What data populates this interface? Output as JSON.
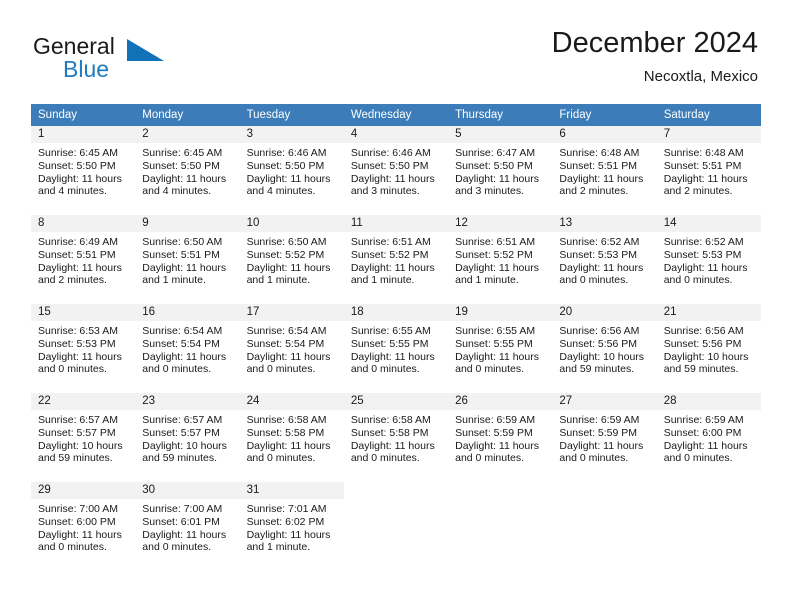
{
  "brand": {
    "line1": "General",
    "line2": "Blue",
    "logo_icon": "triangle-flag-icon",
    "accent_color": "#1272b8"
  },
  "header": {
    "title": "December 2024",
    "subtitle": "Necoxtla, Mexico"
  },
  "calendar": {
    "header_bg": "#3b7cb9",
    "daynum_bg": "#f2f2f2",
    "weekdays": [
      "Sunday",
      "Monday",
      "Tuesday",
      "Wednesday",
      "Thursday",
      "Friday",
      "Saturday"
    ],
    "weeks": [
      [
        {
          "day": "1",
          "sunrise": "Sunrise: 6:45 AM",
          "sunset": "Sunset: 5:50 PM",
          "daylight1": "Daylight: 11 hours",
          "daylight2": "and 4 minutes."
        },
        {
          "day": "2",
          "sunrise": "Sunrise: 6:45 AM",
          "sunset": "Sunset: 5:50 PM",
          "daylight1": "Daylight: 11 hours",
          "daylight2": "and 4 minutes."
        },
        {
          "day": "3",
          "sunrise": "Sunrise: 6:46 AM",
          "sunset": "Sunset: 5:50 PM",
          "daylight1": "Daylight: 11 hours",
          "daylight2": "and 4 minutes."
        },
        {
          "day": "4",
          "sunrise": "Sunrise: 6:46 AM",
          "sunset": "Sunset: 5:50 PM",
          "daylight1": "Daylight: 11 hours",
          "daylight2": "and 3 minutes."
        },
        {
          "day": "5",
          "sunrise": "Sunrise: 6:47 AM",
          "sunset": "Sunset: 5:50 PM",
          "daylight1": "Daylight: 11 hours",
          "daylight2": "and 3 minutes."
        },
        {
          "day": "6",
          "sunrise": "Sunrise: 6:48 AM",
          "sunset": "Sunset: 5:51 PM",
          "daylight1": "Daylight: 11 hours",
          "daylight2": "and 2 minutes."
        },
        {
          "day": "7",
          "sunrise": "Sunrise: 6:48 AM",
          "sunset": "Sunset: 5:51 PM",
          "daylight1": "Daylight: 11 hours",
          "daylight2": "and 2 minutes."
        }
      ],
      [
        {
          "day": "8",
          "sunrise": "Sunrise: 6:49 AM",
          "sunset": "Sunset: 5:51 PM",
          "daylight1": "Daylight: 11 hours",
          "daylight2": "and 2 minutes."
        },
        {
          "day": "9",
          "sunrise": "Sunrise: 6:50 AM",
          "sunset": "Sunset: 5:51 PM",
          "daylight1": "Daylight: 11 hours",
          "daylight2": "and 1 minute."
        },
        {
          "day": "10",
          "sunrise": "Sunrise: 6:50 AM",
          "sunset": "Sunset: 5:52 PM",
          "daylight1": "Daylight: 11 hours",
          "daylight2": "and 1 minute."
        },
        {
          "day": "11",
          "sunrise": "Sunrise: 6:51 AM",
          "sunset": "Sunset: 5:52 PM",
          "daylight1": "Daylight: 11 hours",
          "daylight2": "and 1 minute."
        },
        {
          "day": "12",
          "sunrise": "Sunrise: 6:51 AM",
          "sunset": "Sunset: 5:52 PM",
          "daylight1": "Daylight: 11 hours",
          "daylight2": "and 1 minute."
        },
        {
          "day": "13",
          "sunrise": "Sunrise: 6:52 AM",
          "sunset": "Sunset: 5:53 PM",
          "daylight1": "Daylight: 11 hours",
          "daylight2": "and 0 minutes."
        },
        {
          "day": "14",
          "sunrise": "Sunrise: 6:52 AM",
          "sunset": "Sunset: 5:53 PM",
          "daylight1": "Daylight: 11 hours",
          "daylight2": "and 0 minutes."
        }
      ],
      [
        {
          "day": "15",
          "sunrise": "Sunrise: 6:53 AM",
          "sunset": "Sunset: 5:53 PM",
          "daylight1": "Daylight: 11 hours",
          "daylight2": "and 0 minutes."
        },
        {
          "day": "16",
          "sunrise": "Sunrise: 6:54 AM",
          "sunset": "Sunset: 5:54 PM",
          "daylight1": "Daylight: 11 hours",
          "daylight2": "and 0 minutes."
        },
        {
          "day": "17",
          "sunrise": "Sunrise: 6:54 AM",
          "sunset": "Sunset: 5:54 PM",
          "daylight1": "Daylight: 11 hours",
          "daylight2": "and 0 minutes."
        },
        {
          "day": "18",
          "sunrise": "Sunrise: 6:55 AM",
          "sunset": "Sunset: 5:55 PM",
          "daylight1": "Daylight: 11 hours",
          "daylight2": "and 0 minutes."
        },
        {
          "day": "19",
          "sunrise": "Sunrise: 6:55 AM",
          "sunset": "Sunset: 5:55 PM",
          "daylight1": "Daylight: 11 hours",
          "daylight2": "and 0 minutes."
        },
        {
          "day": "20",
          "sunrise": "Sunrise: 6:56 AM",
          "sunset": "Sunset: 5:56 PM",
          "daylight1": "Daylight: 10 hours",
          "daylight2": "and 59 minutes."
        },
        {
          "day": "21",
          "sunrise": "Sunrise: 6:56 AM",
          "sunset": "Sunset: 5:56 PM",
          "daylight1": "Daylight: 10 hours",
          "daylight2": "and 59 minutes."
        }
      ],
      [
        {
          "day": "22",
          "sunrise": "Sunrise: 6:57 AM",
          "sunset": "Sunset: 5:57 PM",
          "daylight1": "Daylight: 10 hours",
          "daylight2": "and 59 minutes."
        },
        {
          "day": "23",
          "sunrise": "Sunrise: 6:57 AM",
          "sunset": "Sunset: 5:57 PM",
          "daylight1": "Daylight: 10 hours",
          "daylight2": "and 59 minutes."
        },
        {
          "day": "24",
          "sunrise": "Sunrise: 6:58 AM",
          "sunset": "Sunset: 5:58 PM",
          "daylight1": "Daylight: 11 hours",
          "daylight2": "and 0 minutes."
        },
        {
          "day": "25",
          "sunrise": "Sunrise: 6:58 AM",
          "sunset": "Sunset: 5:58 PM",
          "daylight1": "Daylight: 11 hours",
          "daylight2": "and 0 minutes."
        },
        {
          "day": "26",
          "sunrise": "Sunrise: 6:59 AM",
          "sunset": "Sunset: 5:59 PM",
          "daylight1": "Daylight: 11 hours",
          "daylight2": "and 0 minutes."
        },
        {
          "day": "27",
          "sunrise": "Sunrise: 6:59 AM",
          "sunset": "Sunset: 5:59 PM",
          "daylight1": "Daylight: 11 hours",
          "daylight2": "and 0 minutes."
        },
        {
          "day": "28",
          "sunrise": "Sunrise: 6:59 AM",
          "sunset": "Sunset: 6:00 PM",
          "daylight1": "Daylight: 11 hours",
          "daylight2": "and 0 minutes."
        }
      ],
      [
        {
          "day": "29",
          "sunrise": "Sunrise: 7:00 AM",
          "sunset": "Sunset: 6:00 PM",
          "daylight1": "Daylight: 11 hours",
          "daylight2": "and 0 minutes."
        },
        {
          "day": "30",
          "sunrise": "Sunrise: 7:00 AM",
          "sunset": "Sunset: 6:01 PM",
          "daylight1": "Daylight: 11 hours",
          "daylight2": "and 0 minutes."
        },
        {
          "day": "31",
          "sunrise": "Sunrise: 7:01 AM",
          "sunset": "Sunset: 6:02 PM",
          "daylight1": "Daylight: 11 hours",
          "daylight2": "and 1 minute."
        },
        {
          "day": "",
          "sunrise": "",
          "sunset": "",
          "daylight1": "",
          "daylight2": ""
        },
        {
          "day": "",
          "sunrise": "",
          "sunset": "",
          "daylight1": "",
          "daylight2": ""
        },
        {
          "day": "",
          "sunrise": "",
          "sunset": "",
          "daylight1": "",
          "daylight2": ""
        },
        {
          "day": "",
          "sunrise": "",
          "sunset": "",
          "daylight1": "",
          "daylight2": ""
        }
      ]
    ]
  }
}
